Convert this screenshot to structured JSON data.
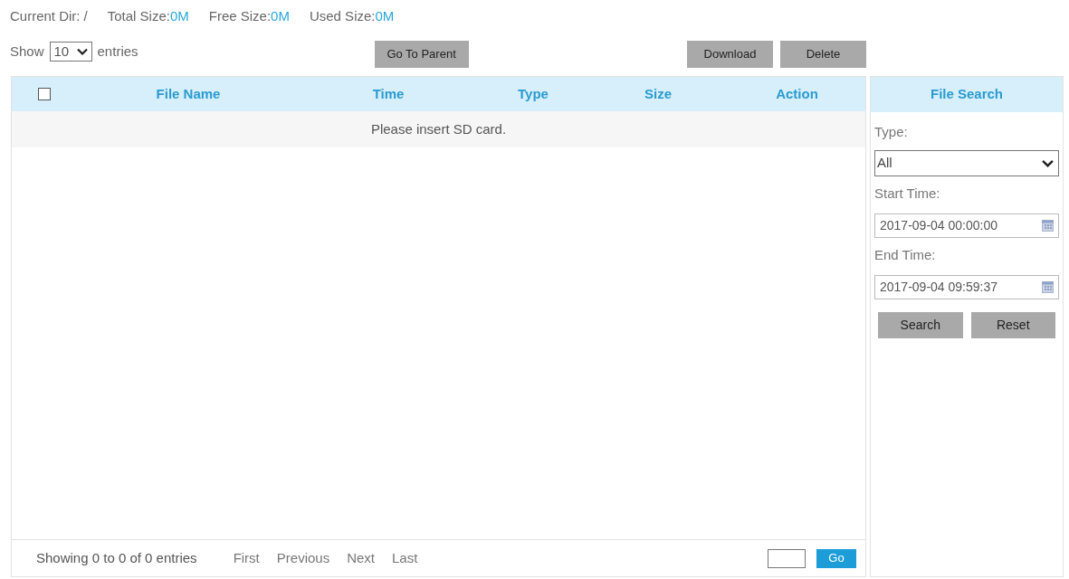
{
  "header": {
    "current_dir": {
      "label": "Current Dir:",
      "value": "/"
    },
    "sizes": [
      {
        "label": "Total Size:",
        "value": "0M"
      },
      {
        "label": "Free Size:",
        "value": "0M"
      },
      {
        "label": "Used Size:",
        "value": "0M"
      }
    ]
  },
  "length_menu": {
    "prefix": "Show",
    "value": "10",
    "suffix": "entries"
  },
  "go_to_parent": "Go To Parent",
  "actions": [
    "Download",
    "Delete"
  ],
  "table": {
    "select_all": {
      "checked": false
    },
    "columns": [
      "File Name",
      "Time",
      "Type",
      "Size",
      "Action"
    ],
    "empty_message": "Please insert SD card."
  },
  "footer": {
    "info": "Showing 0 to 0 of 0 entries",
    "pagination": [
      "First",
      "Previous",
      "Next",
      "Last"
    ],
    "go_button": "Go"
  },
  "search_panel": {
    "title": "File Search",
    "fields": [
      {
        "kind": "select",
        "label": "Type:",
        "value": "All"
      },
      {
        "kind": "datetime",
        "label": "Start Time:",
        "value": "2017-09-04 00:00:00"
      },
      {
        "kind": "datetime",
        "label": "End Time:",
        "value": "2017-09-04 09:59:37"
      }
    ],
    "buttons": [
      "Search",
      "Reset"
    ]
  }
}
